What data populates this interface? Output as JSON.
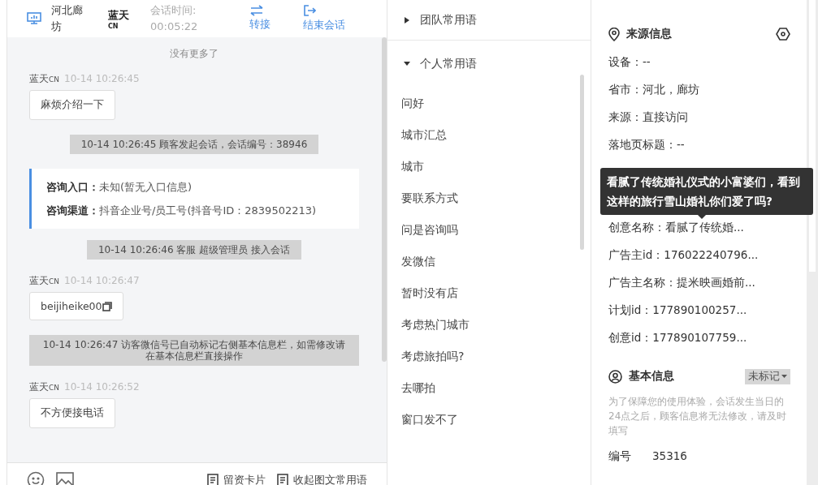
{
  "header": {
    "location": "河北廊坊",
    "agent": {
      "name": "蓝天",
      "badge": "CN"
    },
    "duration_label": "会话时间:",
    "duration": "00:05:22",
    "actions": [
      {
        "kind": "transfer",
        "label": "转接"
      },
      {
        "kind": "end",
        "label": "结束会话"
      }
    ]
  },
  "chat": {
    "no_more": "没有更多了",
    "messages": [
      {
        "kind": "visitor",
        "sender": "蓝天",
        "badge": "CN",
        "time": "10-14 10:26:45",
        "text": "麻烦介绍一下",
        "copyable": false
      },
      {
        "kind": "system",
        "text": "10-14 10:26:45 顾客发起会话，会话编号：38946"
      },
      {
        "kind": "info",
        "lines": [
          {
            "label": "咨询入口：",
            "value": "未知(暂无入口信息)"
          },
          {
            "label": "咨询渠道：",
            "value": "抖音企业号/员工号(抖音号ID：2839502213)"
          }
        ]
      },
      {
        "kind": "system",
        "text": "10-14 10:26:46 客服 超级管理员 接入会话"
      },
      {
        "kind": "visitor",
        "sender": "蓝天",
        "badge": "CN",
        "time": "10-14 10:26:47",
        "text": "beijiheike00",
        "copyable": true
      },
      {
        "kind": "system",
        "text": "10-14 10:26:47 访客微信号已自动标记右侧基本信息栏，如需修改请在基本信息栏直接操作"
      },
      {
        "kind": "visitor",
        "sender": "蓝天",
        "badge": "CN",
        "time": "10-14 10:26:52",
        "text": "不方便接电话",
        "copyable": false
      }
    ]
  },
  "toolbar": {
    "actions": [
      {
        "label": "留资卡片"
      },
      {
        "label": "收起图文常用语"
      }
    ]
  },
  "phrases": {
    "groups": [
      {
        "title": "团队常用语",
        "expanded": false
      },
      {
        "title": "个人常用语",
        "expanded": true,
        "items": [
          "问好",
          "城市汇总",
          "城市",
          "要联系方式",
          "问是咨询吗",
          "发微信",
          "暂时没有店",
          "考虑热门城市",
          "考虑旅拍吗?",
          "去哪拍",
          "窗口发不了"
        ]
      }
    ]
  },
  "source": {
    "title": "来源信息",
    "rows": [
      "设备：--",
      "省市：河北，廊坊",
      "来源：直接访问",
      "落地页标题：--"
    ],
    "tooltip": "看腻了传统婚礼仪式的小富婆们，看到这样的旅行雪山婚礼你们爱了吗?",
    "rows_after": [
      "创意名称：看腻了传统婚...",
      "广告主id：176022240796...",
      "广告主名称：提米映画婚前...",
      "计划id：177890100257...",
      "创意id：177890107759..."
    ]
  },
  "basic": {
    "title": "基本信息",
    "tag": "未标记",
    "note": "为了保障您的使用体验，会话发生当日的24点之后，顾客信息将无法修改，请及时填写",
    "fields": [
      {
        "label": "编号",
        "value": "35316"
      }
    ]
  }
}
